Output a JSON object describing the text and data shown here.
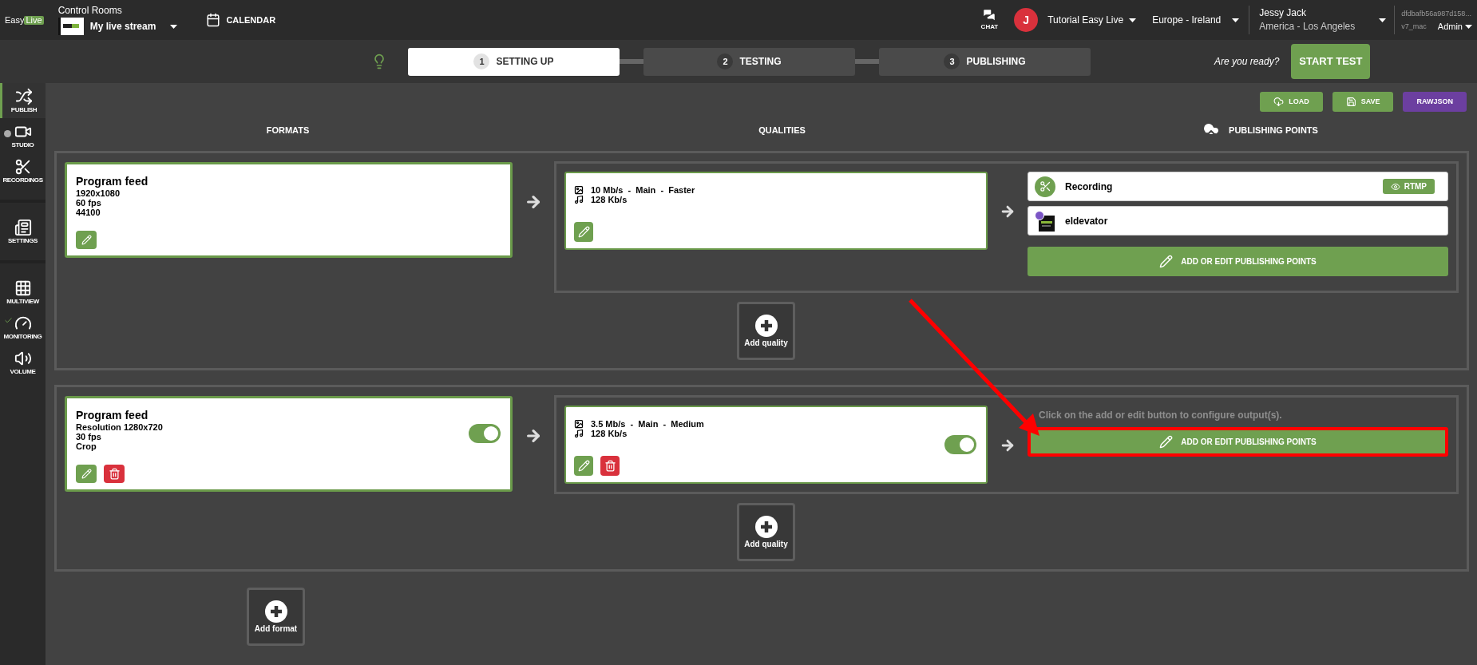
{
  "topbar": {
    "logo": {
      "first": "Easy",
      "second": "Live"
    },
    "rooms_label": "Control Rooms",
    "room": "My live stream",
    "calendar": "CALENDAR",
    "chat": "CHAT",
    "avatar": "J",
    "organization": "Tutorial Easy Live",
    "region": "Europe - Ireland",
    "user_name": "Jessy Jack",
    "user_timezone": "America - Los Angeles",
    "session_id": "dfdbafb56a987d158...",
    "version": "v7_mac",
    "role": "Admin"
  },
  "steps": [
    {
      "number": "1",
      "label": "SETTING UP",
      "selected": true
    },
    {
      "number": "2",
      "label": "TESTING",
      "selected": false
    },
    {
      "number": "3",
      "label": "PUBLISHING",
      "selected": false
    }
  ],
  "ready_prompt": "Are you ready?",
  "start_button": "START TEST",
  "sidebar": [
    [
      {
        "kind": "publish",
        "label": "PUBLISH",
        "selected": true
      },
      {
        "kind": "studio",
        "label": "STUDIO",
        "selected": false,
        "badge": {
          "kind": "dot"
        }
      },
      {
        "kind": "recordings",
        "label": "RECORDINGS",
        "selected": false
      }
    ],
    [
      {
        "kind": "settings",
        "label": "SETTINGS",
        "selected": false
      }
    ],
    [
      {
        "kind": "multiview",
        "label": "MULTIVIEW",
        "selected": false
      },
      {
        "kind": "monitoring",
        "label": "MONITORING",
        "selected": false,
        "badge": {
          "kind": "check"
        }
      },
      {
        "kind": "volume",
        "label": "VOLUME",
        "selected": false
      }
    ]
  ],
  "actions": [
    {
      "kind": "load",
      "label": "LOAD"
    },
    {
      "kind": "save",
      "label": "SAVE"
    },
    {
      "kind": "raw",
      "label": "RAWJSON"
    }
  ],
  "columns": [
    "FORMATS",
    "QUALITIES",
    "PUBLISHING POINTS"
  ],
  "format_groups": [
    {
      "format": {
        "title": "Program feed",
        "lines": [
          "1920x1080",
          "60 fps",
          "44100"
        ],
        "tools": [
          {
            "kind": "edit"
          }
        ]
      },
      "qualities": [
        {
          "video": "10 Mb/s  -  Main  -  Faster",
          "audio": "128 Kb/s",
          "tools": [
            {
              "kind": "edit"
            }
          ],
          "publishing": {
            "points": [
              {
                "kind": "recording",
                "name": "Recording",
                "tag": "RTMP"
              },
              {
                "kind": "stream",
                "name": "eldevator"
              }
            ],
            "button": {
              "label": "ADD OR EDIT PUBLISHING POINTS",
              "highlighted": false
            }
          }
        }
      ],
      "add_quality": "Add quality"
    },
    {
      "format": {
        "title": "Program feed",
        "lines": [
          "Resolution 1280x720",
          "30 fps",
          "Crop"
        ],
        "tools": [
          {
            "kind": "edit"
          },
          {
            "kind": "delete"
          }
        ],
        "switch": {
          "on": true
        }
      },
      "qualities": [
        {
          "video": "3.5 Mb/s  -  Main  -  Medium",
          "audio": "128 Kb/s",
          "tools": [
            {
              "kind": "edit"
            },
            {
              "kind": "delete"
            }
          ],
          "switch": {
            "on": true
          },
          "publishing": {
            "hint": "Click on the add or edit button to configure output(s).",
            "button": {
              "label": "ADD OR EDIT PUBLISHING POINTS",
              "highlighted": true
            }
          }
        }
      ],
      "add_quality": "Add quality"
    }
  ],
  "add_format": "Add format"
}
